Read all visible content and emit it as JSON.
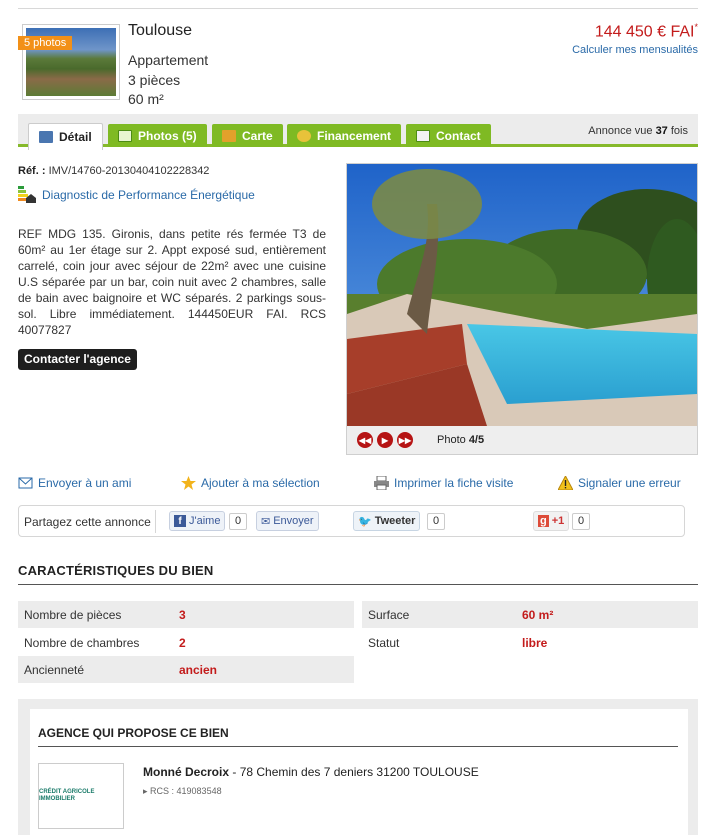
{
  "listing": {
    "thumb_badge": "5 photos",
    "city": "Toulouse",
    "type": "Appartement",
    "rooms": "3 pièces",
    "area": "60 m²",
    "price": "144 450 € FAI",
    "price_mark": "*",
    "calc_link": "Calculer mes mensualités"
  },
  "tabs": [
    {
      "label": "Détail",
      "icon": "detail-icon",
      "color": "#4a76b0"
    },
    {
      "label": "Photos (5)",
      "icon": "photos-icon",
      "color": "#7fba23"
    },
    {
      "label": "Carte",
      "icon": "map-icon",
      "color": "#e2a12b"
    },
    {
      "label": "Financement",
      "icon": "coins-icon",
      "color": "#e8c23a"
    },
    {
      "label": "Contact",
      "icon": "contact-icon",
      "color": "#f2f2f2"
    }
  ],
  "views": {
    "prefix": "Annonce vue",
    "count": "37",
    "suffix": "fois"
  },
  "ref": {
    "label": "Réf. :",
    "value": "IMV/14760-20130404102228342"
  },
  "dpe_link": "Diagnostic de Performance Énergétique",
  "description": "REF MDG 135. Gironis, dans petite rés fermée T3 de 60m² au 1er étage sur 2. Appt exposé sud, entièrement carrelé, coin jour avec séjour de 22m² avec une cuisine U.S séparée par un bar, coin nuit avec 2 chambres, salle de bain avec baignoire et WC séparés. 2 parkings sous-sol. Libre immédiatement. 144450EUR FAI. RCS 40077827",
  "contact_button": "Contacter l'agence",
  "photo": {
    "label": "Photo",
    "counter": "4/5"
  },
  "actions": [
    {
      "label": "Envoyer à un ami",
      "icon": "mail-icon"
    },
    {
      "label": "Ajouter à ma sélection",
      "icon": "star-icon"
    },
    {
      "label": "Imprimer la fiche visite",
      "icon": "printer-icon"
    },
    {
      "label": "Signaler une erreur",
      "icon": "warning-icon"
    }
  ],
  "share": {
    "label": "Partagez cette annonce",
    "like": "J'aime",
    "like_count": "0",
    "send": "Envoyer",
    "tweet": "Tweeter",
    "tweet_count": "0",
    "gplus": "+1",
    "gplus_count": "0"
  },
  "characteristics": {
    "title": "CARACTÉRISTIQUES DU BIEN",
    "rows": [
      {
        "label": "Nombre de pièces",
        "value": "3"
      },
      {
        "label": "Surface",
        "value": "60 m²"
      },
      {
        "label": "Nombre de chambres",
        "value": "2"
      },
      {
        "label": "Statut",
        "value": "libre"
      },
      {
        "label": "Ancienneté",
        "value": "ancien"
      }
    ]
  },
  "agency": {
    "title": "AGENCE QUI PROPOSE CE BIEN",
    "logo_text": "CRÉDIT AGRICOLE IMMOBILIER",
    "name": "Monné Decroix",
    "address": "- 78 Chemin des 7 deniers 31200 TOULOUSE",
    "rcs": "RCS : 419083548"
  },
  "colors": {
    "accent_green": "#7fba23",
    "price_red": "#c31b1b",
    "link_blue": "#2a6aa8"
  }
}
